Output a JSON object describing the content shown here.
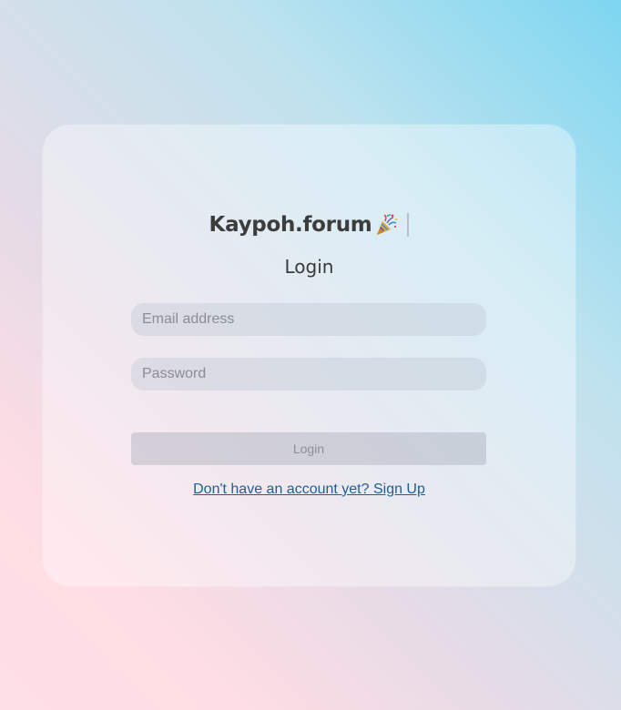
{
  "brand": {
    "title": "Kaypoh.forum",
    "icon": "party-popper-icon"
  },
  "login_form": {
    "heading": "Login",
    "email_placeholder": "Email address",
    "password_placeholder": "Password",
    "submit_label": "Login",
    "signup_link_label": "Don't have an account yet? Sign Up"
  },
  "colors": {
    "accent_link": "#1f5f8f",
    "title_text": "#3c3c3c"
  }
}
